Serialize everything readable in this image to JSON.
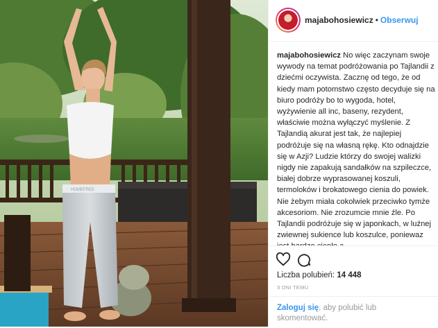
{
  "header": {
    "username": "majabohosiewicz",
    "separator": "•",
    "follow_label": "Obserwuj"
  },
  "photo": {
    "shorts_brand": "HOMEFREE"
  },
  "caption": {
    "user": "majabohosiewicz",
    "text": "No więc zaczynam swoje wywody na temat podróżowania po Tajlandii z dziećmi oczywista. Zacznę od tego, że od kiedy mam potomstwo często decyduje się na biuro podróży bo to wygoda, hotel, wyżywienie all inc, baseny, rezydent, właściwie można wyłączyć myślenie. Z Tajlandią akurat jest tak, że najlepiej podróżuje się na własną rękę. Kto odnajdzie się w Azji? Ludzie którzy do swojej walizki nigdy nie zapakują sandałków na szpileczce, białej dobrze wyprasowanej koszuli, termoloków i brokatowego cienia do powiek. Nie żebym miała cokolwiek przeciwko tymże akcesoriom. Nie zrozumcie mnie źle. Po Tajlandii podróżuje się w japonkach, w luźnej zwiewnej sukience lub koszulce, poniewaz jest bardzo ciepło a"
  },
  "actions": {
    "like_icon": "heart-icon",
    "comment_icon": "comment-icon",
    "likes_label": "Liczba polubień:",
    "likes_count": "14 448",
    "date": "3 DNI TEMU"
  },
  "comment": {
    "login_label": "Zaloguj się",
    "rest": ", aby polubić lub skomentować."
  },
  "colors": {
    "accent": "#3897f0",
    "text": "#262626",
    "muted": "#999999"
  }
}
